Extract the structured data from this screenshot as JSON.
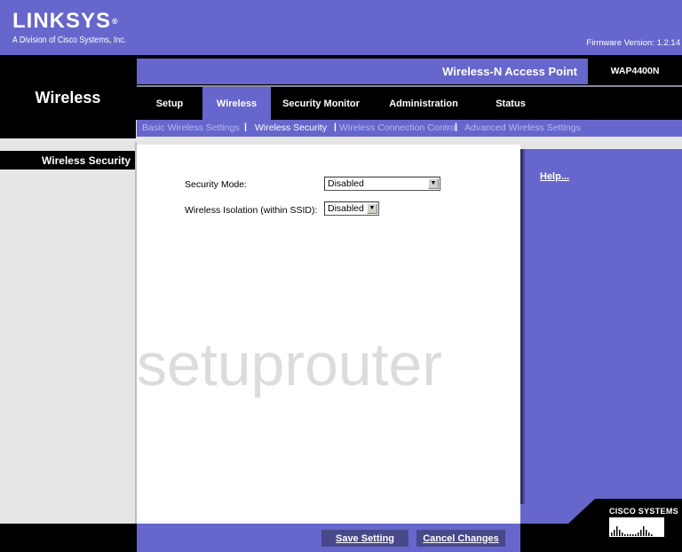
{
  "header": {
    "brand": "LINKSYS",
    "brand_mark": "®",
    "brand_subtitle": "A Division of Cisco Systems, Inc.",
    "firmware": "Firmware Version: 1.2.14",
    "product_name": "Wireless-N Access Point",
    "model": "WAP4400N"
  },
  "section_title": "Wireless",
  "tabs": [
    {
      "label": "Setup",
      "active": false
    },
    {
      "label": "Wireless",
      "active": true
    },
    {
      "label": "Security Monitor",
      "active": false
    },
    {
      "label": "Administration",
      "active": false
    },
    {
      "label": "Status",
      "active": false
    }
  ],
  "subnav": [
    {
      "label": "Basic Wireless Settings",
      "active": false
    },
    {
      "label": "Wireless Security",
      "active": true
    },
    {
      "label": "Wireless Connection Control",
      "active": false
    },
    {
      "label": "Advanced Wireless Settings",
      "active": false
    }
  ],
  "subnav_separator": "|",
  "left_section": "Wireless Security",
  "form": {
    "security_mode": {
      "label": "Security Mode:",
      "value": "Disabled"
    },
    "wireless_isolation": {
      "label": "Wireless Isolation (within SSID):",
      "value": "Disabled"
    }
  },
  "help_link": "Help...",
  "watermark": "setuprouter",
  "footer": {
    "save_label": "Save Setting",
    "cancel_label": "Cancel Changes",
    "cisco_text": "CISCO SYSTEMS"
  },
  "colors": {
    "brand_purple": "#6666cc",
    "black": "#000000",
    "button": "#48488a",
    "subnav_inactive": "#b9b9f0"
  }
}
